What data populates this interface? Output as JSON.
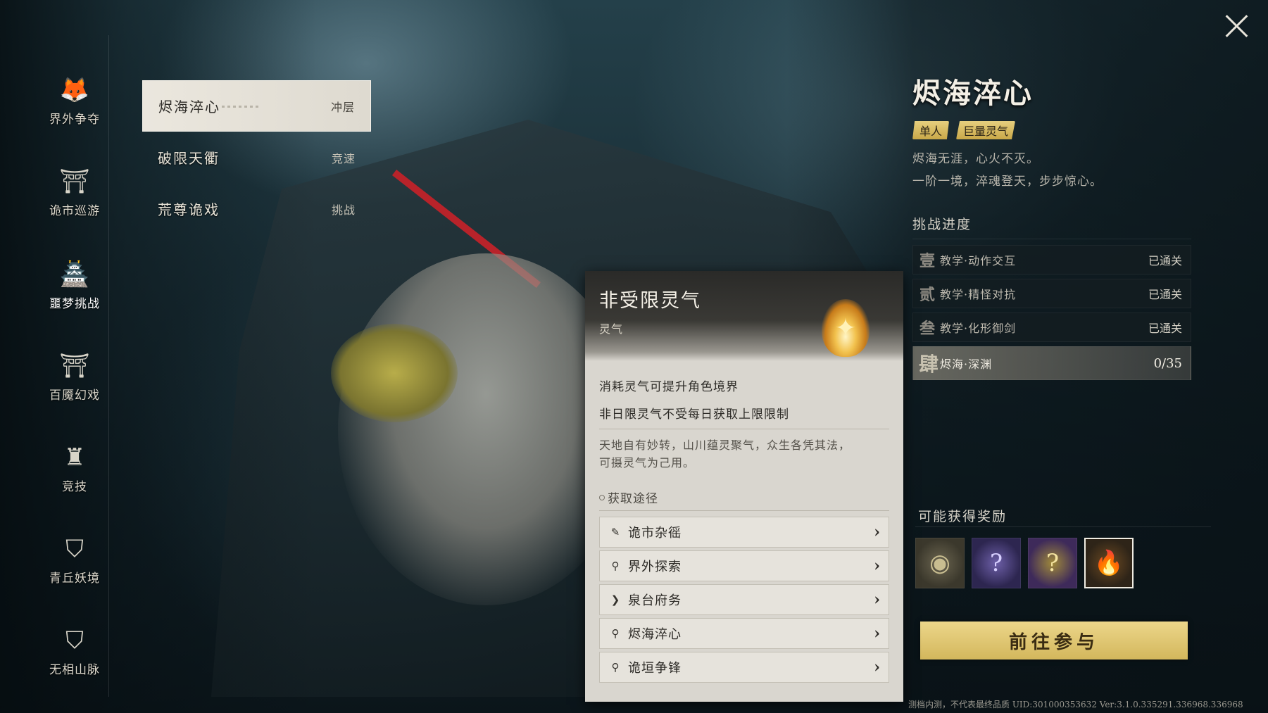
{
  "nav": [
    {
      "label": "界外争夺",
      "icon": "fox-icon",
      "glyph": "🦊"
    },
    {
      "label": "诡市巡游",
      "icon": "market-gate-icon",
      "glyph": "⛩"
    },
    {
      "label": "噩梦挑战",
      "icon": "pagoda-icon",
      "glyph": "🏯"
    },
    {
      "label": "百魇幻戏",
      "icon": "theater-icon",
      "glyph": "⛩"
    },
    {
      "label": "竞技",
      "icon": "arena-icon",
      "glyph": "♜"
    },
    {
      "label": "青丘妖境",
      "icon": "fox-shield-icon",
      "glyph": "⛉"
    },
    {
      "label": "无相山脉",
      "icon": "mountain-shield-icon",
      "glyph": "⛉"
    }
  ],
  "modes": [
    {
      "name": "烬海淬心",
      "tag": "冲层"
    },
    {
      "name": "破限天衢",
      "tag": "竞速"
    },
    {
      "name": "荒尊诡戏",
      "tag": "挑战"
    }
  ],
  "detail": {
    "title": "烬海淬心",
    "tags": [
      "单人",
      "巨量灵气"
    ],
    "desc1": "烬海无涯，心火不灭。",
    "desc2": "一阶一境，淬魂登天，步步惊心。",
    "progress_title": "挑战进度",
    "progress": [
      {
        "num": "壹",
        "name": "教学·动作交互",
        "status": "已通关"
      },
      {
        "num": "贰",
        "name": "教学·精怪对抗",
        "status": "已通关"
      },
      {
        "num": "叁",
        "name": "教学·化形御剑",
        "status": "已通关"
      },
      {
        "num": "肆",
        "name": "烬海·深渊",
        "status": "0/35"
      }
    ],
    "rewards_title": "可能获得奖励",
    "rewards": [
      {
        "icon": "coin-icon",
        "glyph": "◉"
      },
      {
        "icon": "purple-mystery-icon",
        "glyph": "?"
      },
      {
        "icon": "gold-mystery-icon",
        "glyph": "?"
      },
      {
        "icon": "flame-icon",
        "glyph": "🔥"
      }
    ],
    "join_label": "前往参与"
  },
  "tooltip": {
    "title": "非受限灵气",
    "subtitle": "灵气",
    "line1": "消耗灵气可提升角色境界",
    "line2": "非日限灵气不受每日获取上限限制",
    "desc_a": "天地自有妙转，山川蕴灵聚气，众生各凭其法，",
    "desc_b": "可摄灵气为己用。",
    "source_title": "获取途径",
    "sources": [
      {
        "name": "诡市杂徭",
        "icon": "brush-icon",
        "glyph": "✎"
      },
      {
        "name": "界外探索",
        "icon": "location-pin-icon",
        "glyph": "⬤"
      },
      {
        "name": "泉台府务",
        "icon": "arrow-right-icon",
        "glyph": "❯"
      },
      {
        "name": "烬海淬心",
        "icon": "location-pin-icon",
        "glyph": "⬤"
      },
      {
        "name": "诡垣争锋",
        "icon": "location-pin-icon",
        "glyph": "⬤"
      }
    ]
  },
  "footer": "测档内测，不代表最终品质 UID:301000353632 Ver:3.1.0.335291.336968.336968"
}
